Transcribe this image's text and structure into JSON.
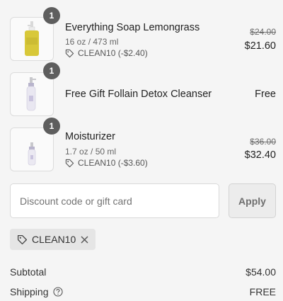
{
  "items": [
    {
      "name": "Everything Soap Lemongrass",
      "quantity": "1",
      "variant": "16 oz / 473 ml",
      "discount": "CLEAN10 (-$2.40)",
      "original_price": "$24.00",
      "price": "$21.60",
      "image": "yellow-pump-bottle"
    },
    {
      "name": "Free Gift Follain Detox Cleanser",
      "quantity": "1",
      "price": "Free",
      "image": "white-pump-bottle"
    },
    {
      "name": "Moisturizer",
      "quantity": "1",
      "variant": "1.7 oz / 50 ml",
      "discount": "CLEAN10 (-$3.60)",
      "original_price": "$36.00",
      "price": "$32.40",
      "image": "small-white-pump-bottle"
    }
  ],
  "discount_form": {
    "placeholder": "Discount code or gift card",
    "apply_label": "Apply"
  },
  "applied_code": {
    "code": "CLEAN10",
    "icons": [
      "tag-icon",
      "close-icon"
    ]
  },
  "summary": {
    "subtotal_label": "Subtotal",
    "subtotal_value": "$54.00",
    "shipping_label": "Shipping",
    "shipping_value": "FREE"
  },
  "colors": {
    "background": "#f5f5f5",
    "badge": "#5e5e5e",
    "button_bg": "#ececec"
  }
}
